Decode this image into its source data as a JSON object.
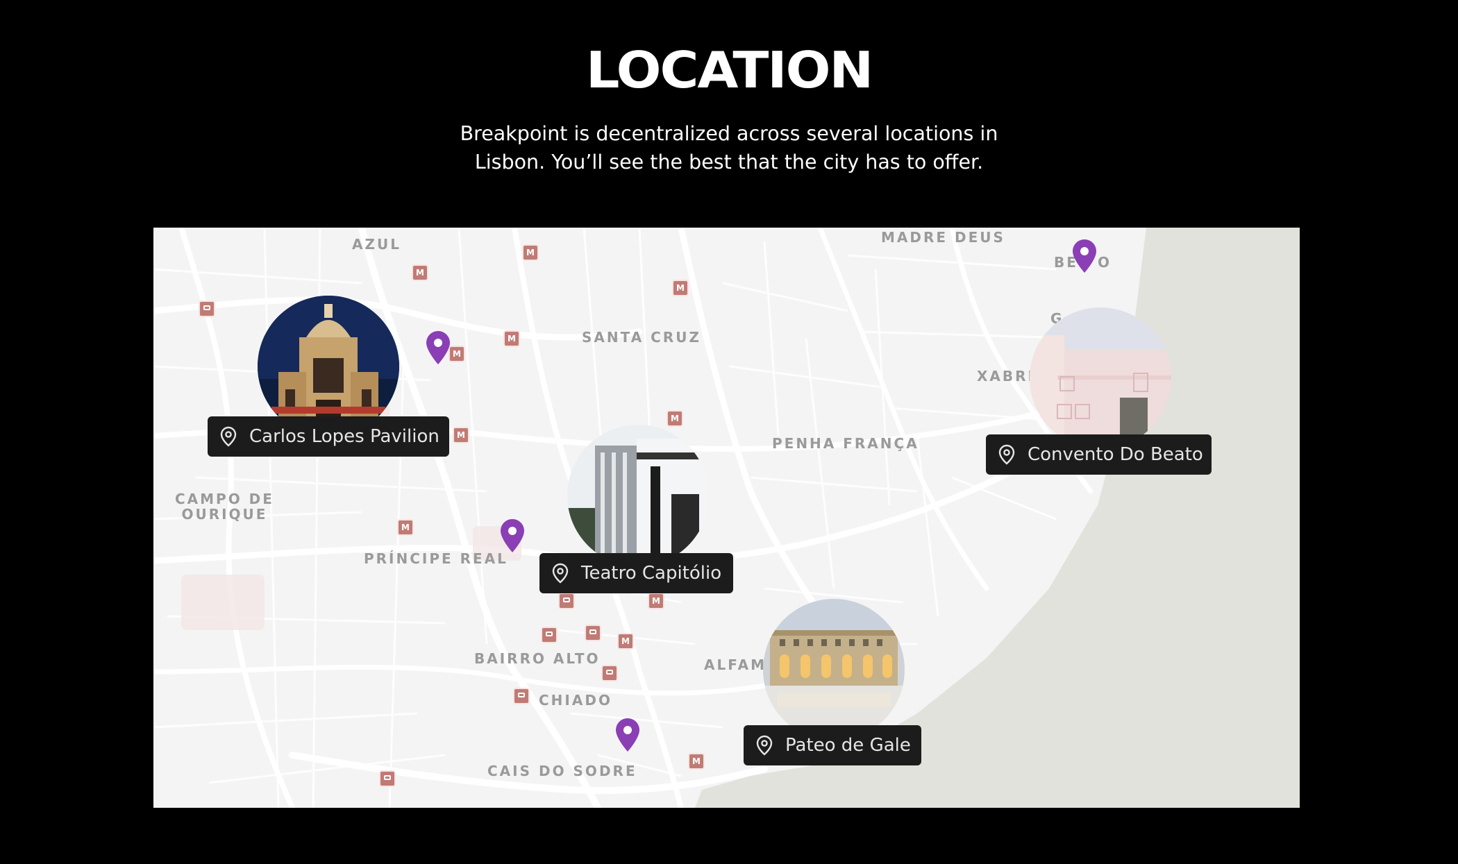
{
  "header": {
    "title": "LOCATION",
    "subtitle": "Breakpoint is decentralized across several locations in Lisbon. You’ll see the best that the city has to offer."
  },
  "map": {
    "districts": [
      "AZUL",
      "MADRE DEUS",
      "SANTA CRUZ",
      "XABRE",
      "PENHA FRANÇA",
      "CAMPO DE\nOURIQUE",
      "PRÍNCIPE REAL",
      "BAIRRO ALTO",
      "CHIADO",
      "ALFAM",
      "CAIS DO SODRE",
      "BE",
      "O",
      "G"
    ],
    "metro_glyph": "M",
    "venues": [
      {
        "name": "Carlos Lopes Pavilion",
        "icon": "location-pin-icon"
      },
      {
        "name": "Teatro Capitólio",
        "icon": "location-pin-icon"
      },
      {
        "name": "Convento Do Beato",
        "icon": "location-pin-icon"
      },
      {
        "name": "Pateo de Gale",
        "icon": "location-pin-icon"
      }
    ],
    "colors": {
      "pin": "#8a3fb5",
      "metro": "#c07b74",
      "water": "#e2e2dc",
      "land": "#f4f4f5"
    }
  }
}
